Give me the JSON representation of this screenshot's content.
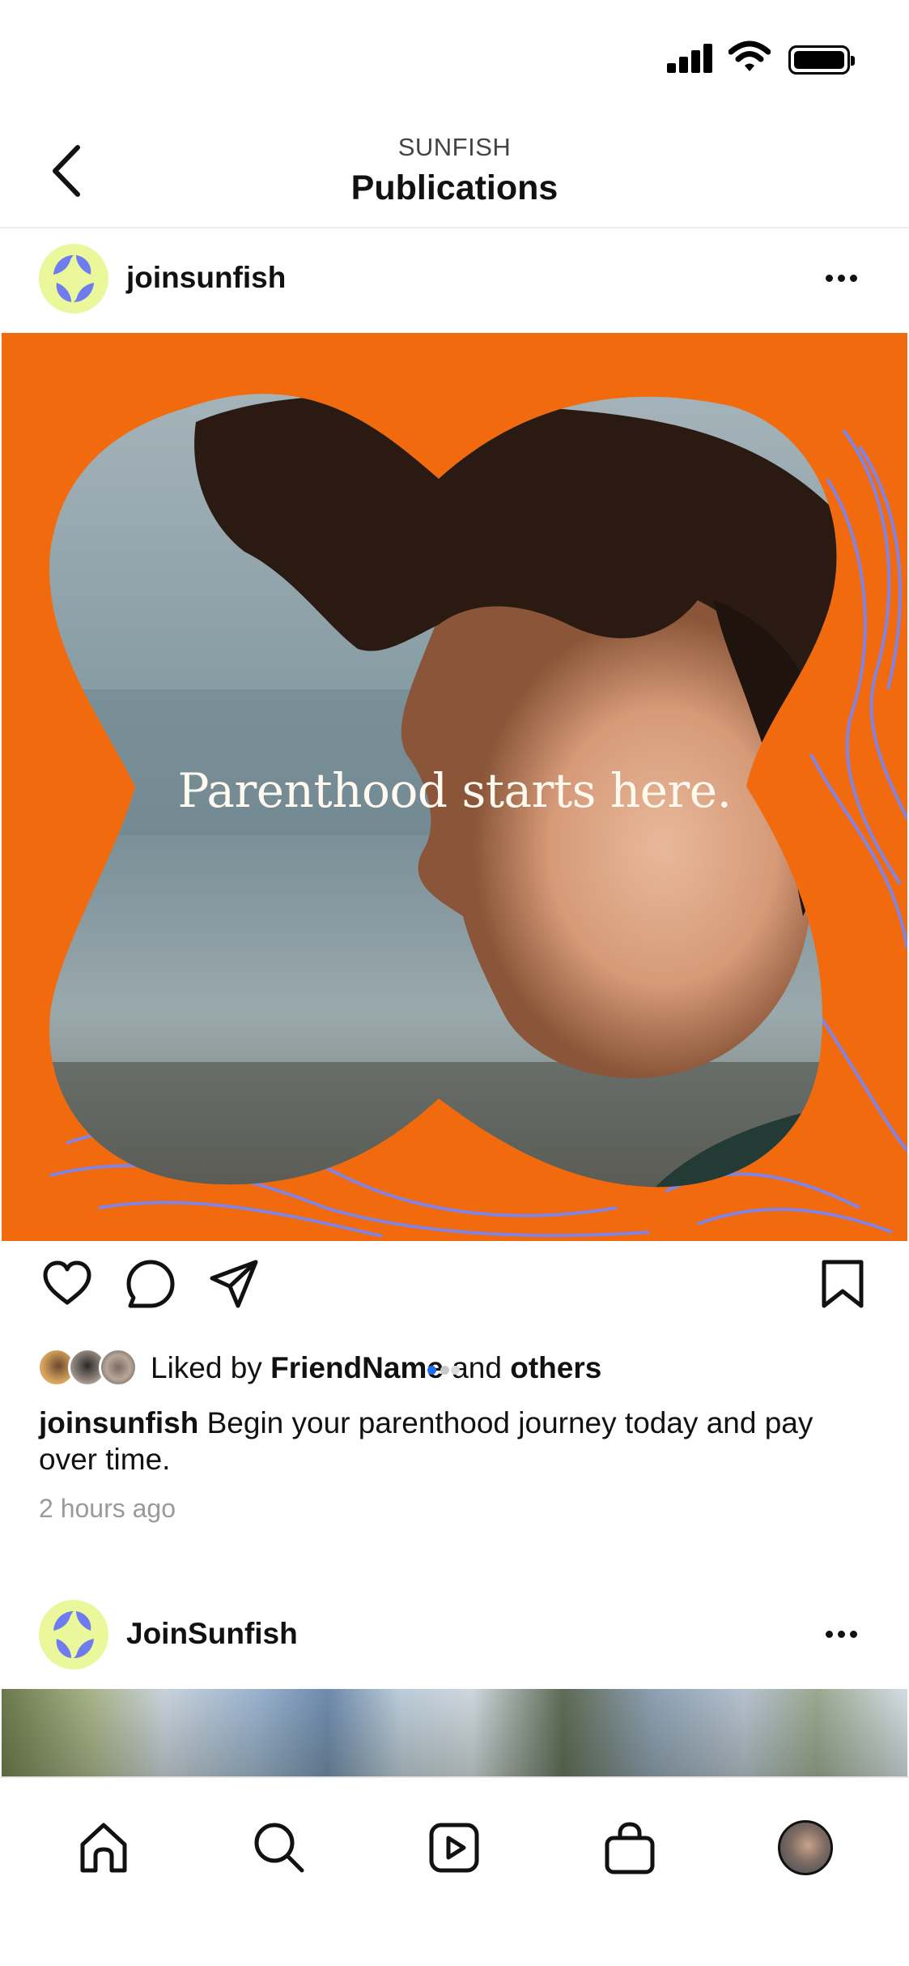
{
  "header": {
    "subtitle": "SUNFISH",
    "title": "Publications"
  },
  "posts": [
    {
      "username": "joinsunfish",
      "image_overlay_text": "Parenthood starts here.",
      "likes": {
        "prefix": "Liked by ",
        "friend": "FriendName",
        "conjunction": " and ",
        "others": "others"
      },
      "caption_user": "joinsunfish",
      "caption_text": " Begin your parenthood journey today and pay over time.",
      "timestamp": "2 hours ago"
    },
    {
      "username": "JoinSunfish"
    }
  ],
  "colors": {
    "brand_orange": "#f26a0e",
    "avatar_bg": "#eaf79a",
    "avatar_mark": "#6f7cf0",
    "accent_blue": "#1d6ff2"
  },
  "icons": {
    "back": "chevron-left-icon",
    "more": "more-horizontal-icon",
    "like": "heart-icon",
    "comment": "comment-icon",
    "share": "send-icon",
    "save": "bookmark-icon",
    "home": "home-icon",
    "search": "search-icon",
    "reels": "play-icon",
    "shop": "shopping-bag-icon",
    "profile": "profile-avatar"
  }
}
